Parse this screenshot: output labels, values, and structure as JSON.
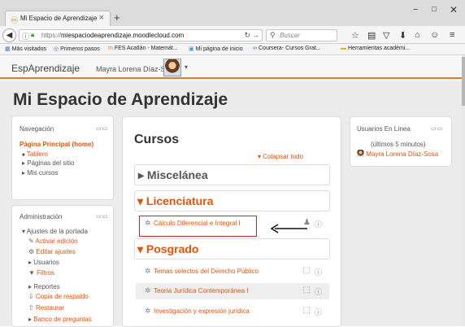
{
  "browser": {
    "tab_title": "Mi Espacio de Aprendizaje",
    "tab_close": "×",
    "new_tab": "+",
    "url_prefix": "https://",
    "url_host": "miespaciodeaprendizaje.moodlecloud.com",
    "search_placeholder": "Buscar",
    "window_controls": {
      "minimize": "−",
      "maximize": "□",
      "close": "✕"
    },
    "bookmarks": [
      {
        "icon": "bookmarks-icon",
        "label": "Más visitados"
      },
      {
        "icon": "firefox-icon",
        "label": "Primeros pasos"
      },
      {
        "icon": "moodle-icon",
        "label": "FES Acatlán - Matemát..."
      },
      {
        "icon": "image-icon",
        "label": "Mi página de inicio"
      },
      {
        "icon": "coursera-icon",
        "label": "Coursera- Cursos Grat..."
      },
      {
        "icon": "folder-icon",
        "label": "Herramientas académi..."
      }
    ]
  },
  "header": {
    "brand": "EspAprendizaje",
    "user": "Mayra Lorena Díaz-Sosa"
  },
  "page_title": "Mi Espacio de Aprendizaje",
  "navigation": {
    "title": "Navegación",
    "items": [
      "Página Principal (home)",
      "Tablero",
      "Páginas del sitio",
      "Mis cursos"
    ]
  },
  "administration": {
    "title": "Administración",
    "root": "Ajustes de la portada",
    "items": [
      "Activar edición",
      "Editar ajustes",
      "Usuarios",
      "Filtros",
      "Reportes",
      "Copia de respaldo",
      "Restaurar",
      "Banco de preguntas"
    ]
  },
  "courses": {
    "title": "Cursos",
    "collapse_all": "Colapsar todo",
    "sections": [
      {
        "title": "Miscelánea",
        "activities": []
      },
      {
        "title": "Licenciatura",
        "activities": [
          "Cálculo Diferencial e Integral I"
        ]
      },
      {
        "title": "Posgrado",
        "activities": [
          "Temas selectos del Derecho Público",
          "Teoría Jurídica Contemporánea I",
          "Investigación y expresión jurídica"
        ]
      }
    ]
  },
  "online_users": {
    "title": "Usuarios En Línea",
    "window": "(últimos 5 minutos)",
    "users": [
      "Mayra Lorena Díaz-Sosa"
    ]
  },
  "colors": {
    "accent": "#e8510a",
    "header_border": "#e87722",
    "highlight_box": "#c0272d"
  }
}
